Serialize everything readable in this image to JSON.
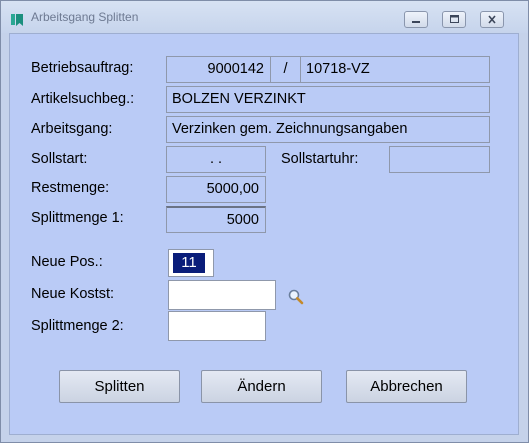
{
  "window": {
    "title": "Arbeitsgang Splitten"
  },
  "labels": {
    "betriebsauftrag": "Betriebsauftrag:",
    "artikelsuchbeg": "Artikelsuchbeg.:",
    "arbeitsgang": "Arbeitsgang:",
    "sollstart": "Sollstart:",
    "sollstartuhr": "Sollstartuhr:",
    "restmenge": "Restmenge:",
    "splittmenge1": "Splittmenge 1:",
    "neue_pos": "Neue Pos.:",
    "neue_kostst": "Neue Kostst:",
    "splittmenge2": "Splittmenge 2:"
  },
  "values": {
    "auftrag_nr": "9000142",
    "separator": "/",
    "auftrag_ref": "10718-VZ",
    "artikel": "BOLZEN VERZINKT",
    "arbeitsgang": "Verzinken gem. Zeichnungsangaben",
    "sollstart": ". .",
    "sollstartuhr": "",
    "restmenge": "5000,00",
    "splittmenge1": "5000"
  },
  "inputs": {
    "neue_pos": "11",
    "neue_kostst": "",
    "splittmenge2": ""
  },
  "buttons": {
    "splitten": "Splitten",
    "aendern": "Ändern",
    "abbrechen": "Abbrechen"
  },
  "icons": {
    "app": "bookmark-icon",
    "search": "search-icon"
  },
  "colors": {
    "client_bg": "#bacbf6",
    "selection": "#0a1d7a",
    "title_icon": "#1a9a8a"
  }
}
